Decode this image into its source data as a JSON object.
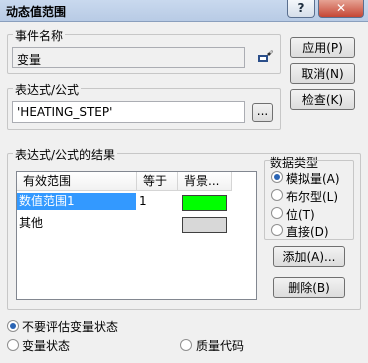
{
  "window": {
    "title": "动态值范围",
    "help_glyph": "?",
    "close_glyph": "✕"
  },
  "event_name": {
    "legend": "事件名称",
    "value": "变量"
  },
  "expression": {
    "legend": "表达式/公式",
    "value": "'HEATING_STEP'",
    "browse_label": "..."
  },
  "buttons": {
    "apply": "应用(P)",
    "cancel": "取消(N)",
    "check": "检查(K)",
    "add": "添加(A)...",
    "delete": "删除(B)"
  },
  "results": {
    "legend": "表达式/公式的结果",
    "columns": [
      "有效范围",
      "等于",
      "背景..."
    ],
    "rows": [
      {
        "range": "数值范围1",
        "equals": "1",
        "color": "#00ff00",
        "selected": true
      },
      {
        "range": "其他",
        "equals": "",
        "color": "#d8d8d8",
        "selected": false
      }
    ]
  },
  "data_type": {
    "legend": "数据类型",
    "options": [
      {
        "label": "模拟量(A)",
        "checked": true
      },
      {
        "label": "布尔型(L)",
        "checked": false
      },
      {
        "label": "位(T)",
        "checked": false
      },
      {
        "label": "直接(D)",
        "checked": false
      }
    ]
  },
  "evaluation": {
    "options": [
      {
        "label": "不要评估变量状态",
        "checked": true
      },
      {
        "label": "变量状态",
        "checked": false
      },
      {
        "label": "质量代码",
        "checked": false
      }
    ]
  }
}
